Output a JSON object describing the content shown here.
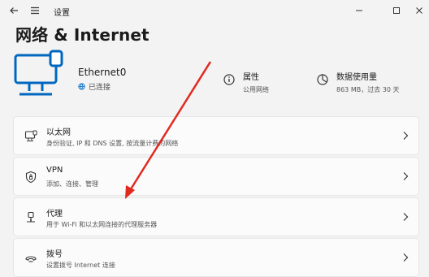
{
  "window": {
    "app_title": "设置",
    "back_icon": "back-arrow-icon",
    "menu_icon": "hamburger-icon"
  },
  "page": {
    "title": "网络 & Internet"
  },
  "device": {
    "name": "Ethernet0",
    "status": "已连接",
    "icon": "ethernet-monitor-icon"
  },
  "properties": {
    "label": "属性",
    "sub": "公用网络"
  },
  "data_usage": {
    "label": "数据使用量",
    "sub": "863 MB，过去 30 天"
  },
  "cards": [
    {
      "title": "以太网",
      "desc": "身份验证, IP 和 DNS 设置, 按流量计费的网络",
      "icon": "ethernet-icon"
    },
    {
      "title": "VPN",
      "desc": "添加、连接、管理",
      "icon": "vpn-shield-icon"
    },
    {
      "title": "代理",
      "desc": "用于 Wi-Fi 和以太网连接的代理服务器",
      "icon": "proxy-icon"
    },
    {
      "title": "拨号",
      "desc": "设置拨号 Internet 连接",
      "icon": "dialup-icon"
    }
  ],
  "colors": {
    "accent": "#0067c0",
    "annotation_arrow": "#e02a1f"
  }
}
